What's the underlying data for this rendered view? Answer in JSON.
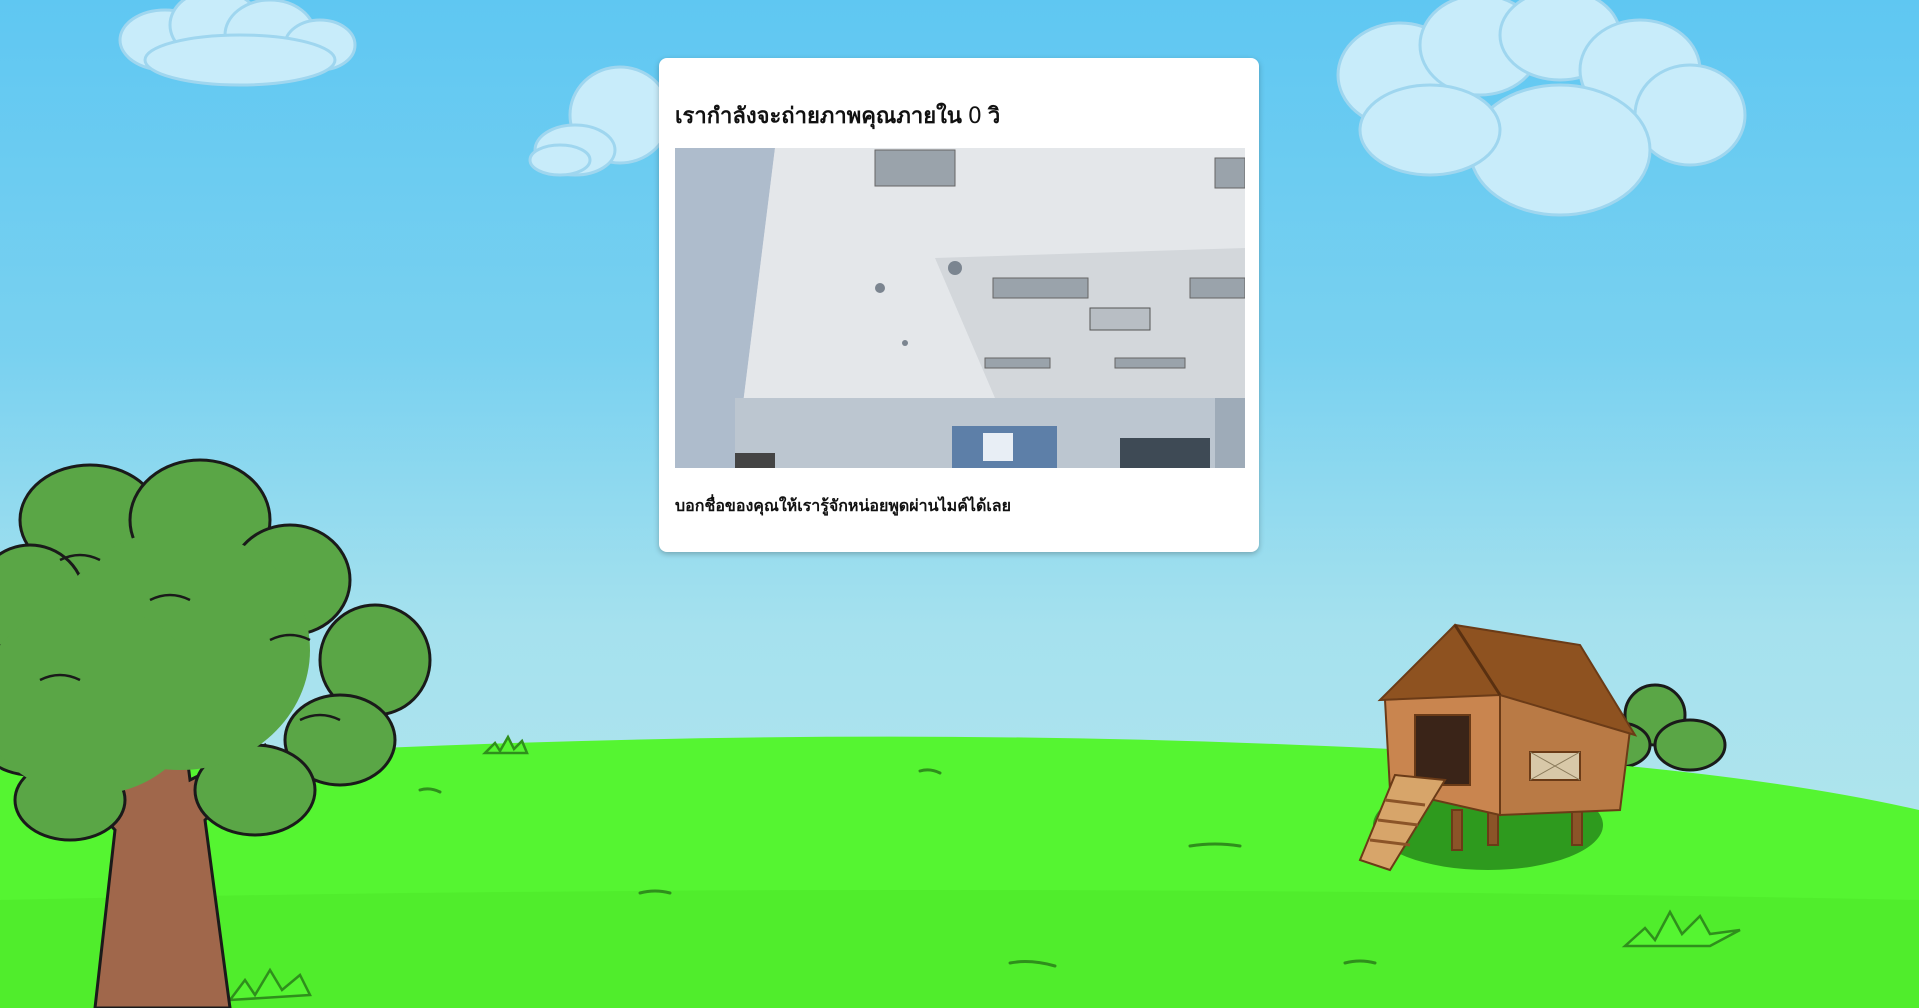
{
  "modal": {
    "title": "เรากำลังจะถ่ายภาพคุณภายใน",
    "countdown": "0",
    "unit": "วิ",
    "hint": "บอกชื่อของคุณให้เรารู้จักหน่อยพูดผ่านไมค์ได้เลย"
  },
  "camera_feed": {
    "icon": "camera-feed"
  },
  "colors": {
    "sky": "#5fc7f2",
    "grass": "#55f531",
    "tree_leaves": "#5aa646",
    "trunk": "#a0674b",
    "house_wall": "#c9854f",
    "house_roof": "#8e5220"
  }
}
